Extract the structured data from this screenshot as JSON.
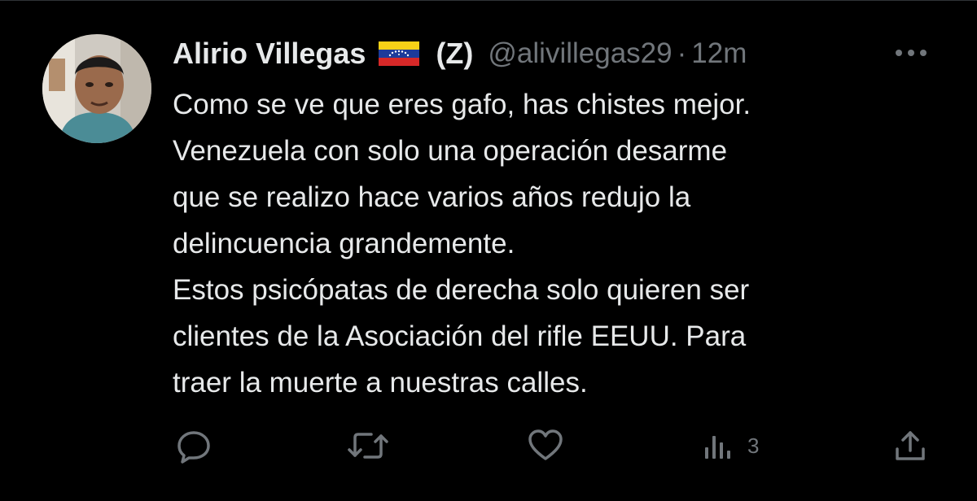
{
  "tweet": {
    "author": {
      "name": "Alirio Villegas",
      "flag_icon": "venezuela-flag-icon",
      "suffix": "(Z)",
      "handle": "@alivillegas29",
      "separator": "·",
      "time": "12m"
    },
    "text_lines": [
      "Como se ve que eres gafo, has chistes mejor.",
      "Venezuela con solo una operación desarme",
      "que se realizo hace varios años redujo la",
      "delincuencia grandemente.",
      "Estos psicópatas de derecha solo quieren ser",
      "clientes de la Asociación del rifle EEUU. Para",
      "traer la muerte a nuestras calles."
    ],
    "actions": {
      "reply_icon": "reply-icon",
      "retweet_icon": "retweet-icon",
      "like_icon": "heart-icon",
      "views_icon": "views-icon",
      "views_count": "3",
      "share_icon": "share-icon"
    }
  },
  "colors": {
    "background": "#000000",
    "text": "#e7e9ea",
    "muted": "#71767b",
    "flag_yellow": "#f7d117",
    "flag_blue": "#1d3b9a",
    "flag_red": "#d62828"
  }
}
